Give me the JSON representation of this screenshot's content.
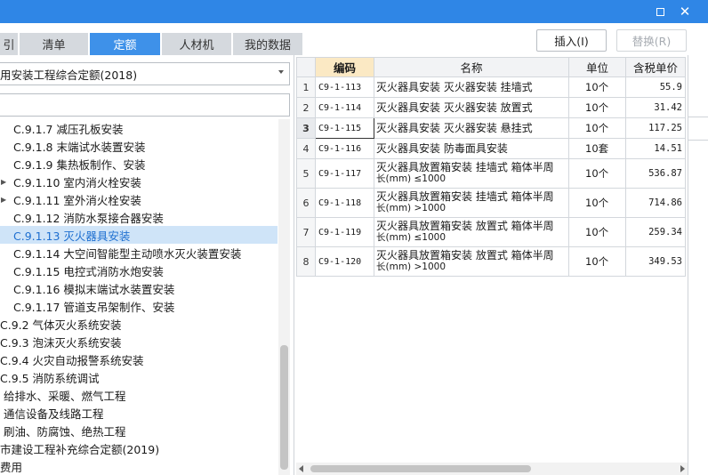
{
  "colors": {
    "titlebar": "#2f86e6",
    "active_tab": "#3e91e9",
    "selected_row": "#cfe4f8",
    "code_header": "#fbe9c4"
  },
  "window": {
    "maximize_icon": "maximize-icon",
    "close_icon": "close-icon",
    "close_glyph": "✕"
  },
  "tabs": [
    {
      "label": "引"
    },
    {
      "label": "清单"
    },
    {
      "label": "定额"
    },
    {
      "label": "人材机"
    },
    {
      "label": "我的数据"
    }
  ],
  "active_tab": "定额",
  "toolbar": {
    "insert_label": "插入(I)",
    "replace_label": "替换(R)"
  },
  "library": {
    "selected": "用安装工程综合定额(2018)"
  },
  "search": {
    "value": "",
    "placeholder": ""
  },
  "tree": [
    {
      "label": "C.9.1.7 减压孔板安装"
    },
    {
      "label": "C.9.1.8 末端试水装置安装"
    },
    {
      "label": "C.9.1.9 集热板制作、安装"
    },
    {
      "label": "C.9.1.10 室内消火栓安装",
      "expander": "▶"
    },
    {
      "label": "C.9.1.11 室外消火栓安装",
      "expander": "▶"
    },
    {
      "label": "C.9.1.12 消防水泵接合器安装"
    },
    {
      "label": "C.9.1.13 灭火器具安装",
      "selected": true
    },
    {
      "label": "C.9.1.14 大空间智能型主动喷水灭火装置安装"
    },
    {
      "label": "C.9.1.15 电控式消防水炮安装"
    },
    {
      "label": "C.9.1.16 模拟末端试水装置安装"
    },
    {
      "label": "C.9.1.17 管道支吊架制作、安装"
    },
    {
      "label": "C.9.2 气体灭火系统安装"
    },
    {
      "label": "C.9.3 泡沫灭火系统安装"
    },
    {
      "label": "C.9.4 火灾自动报警系统安装"
    },
    {
      "label": "C.9.5 消防系统调试"
    },
    {
      "label": "给排水、采暖、燃气工程"
    },
    {
      "label": "通信设备及线路工程"
    },
    {
      "label": "刷油、防腐蚀、绝热工程"
    },
    {
      "label": "市建设工程补充综合定额(2019)"
    },
    {
      "label": "费用"
    }
  ],
  "table": {
    "headers": {
      "code": "编码",
      "name": "名称",
      "unit": "单位",
      "price": "含税单价"
    },
    "rows": [
      {
        "idx": "1",
        "code": "C9-1-113",
        "name": "灭火器具安装 灭火器安装 挂墙式",
        "unit": "10个",
        "price": "55.9"
      },
      {
        "idx": "2",
        "code": "C9-1-114",
        "name": "灭火器具安装 灭火器安装 放置式",
        "unit": "10个",
        "price": "31.42"
      },
      {
        "idx": "3",
        "code": "C9-1-115",
        "name": "灭火器具安装 灭火器安装 悬挂式",
        "unit": "10个",
        "price": "117.25",
        "current": true
      },
      {
        "idx": "4",
        "code": "C9-1-116",
        "name": "灭火器具安装 防毒面具安装",
        "unit": "10套",
        "price": "14.51"
      },
      {
        "idx": "5",
        "code": "C9-1-117",
        "name": "灭火器具放置箱安装 挂墙式 箱体半周",
        "name2": "长(mm) ≤1000",
        "unit": "10个",
        "price": "536.87"
      },
      {
        "idx": "6",
        "code": "C9-1-118",
        "name": "灭火器具放置箱安装 挂墙式 箱体半周",
        "name2": "长(mm) >1000",
        "unit": "10个",
        "price": "714.86"
      },
      {
        "idx": "7",
        "code": "C9-1-119",
        "name": "灭火器具放置箱安装 放置式 箱体半周",
        "name2": "长(mm) ≤1000",
        "unit": "10个",
        "price": "259.34"
      },
      {
        "idx": "8",
        "code": "C9-1-120",
        "name": "灭火器具放置箱安装 放置式 箱体半周",
        "name2": "长(mm) >1000",
        "unit": "10个",
        "price": "349.53"
      }
    ]
  }
}
